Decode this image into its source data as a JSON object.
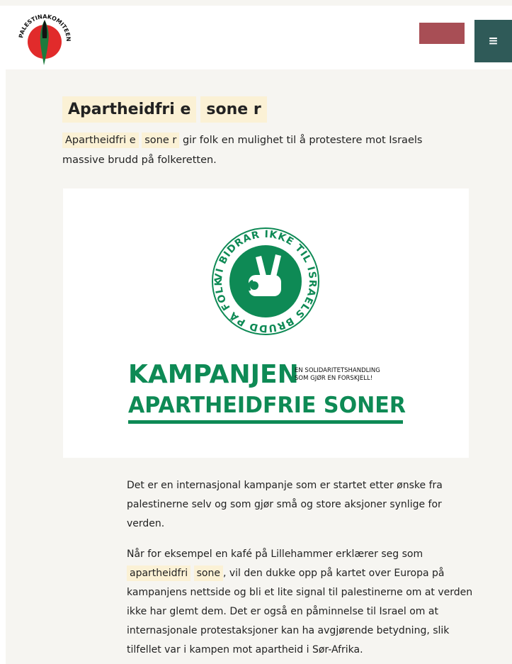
{
  "header": {
    "logo_text": "PALESTINAKOMITEEN I NORGE",
    "menu_icon": "hamburger-icon",
    "colors": {
      "menu_bg": "#2f5a58",
      "red_button": "#a84e55"
    }
  },
  "article": {
    "title_part1": "Apartheidfri e",
    "title_part2": "sone r",
    "lead_hl1": "Apartheidfri e",
    "lead_hl2": "sone r",
    "lead_rest": " gir folk en mulighet til å protestere mot Israels massive brudd på folkeretten.",
    "banner": {
      "badge_text": "VI BIDRAR IKKE TIL ISRAELS BRUDD PÅ FOLKERETTEN",
      "line1": "KAMPANJEN",
      "line2": "APARTHEIDFRIE SONER",
      "tagline1": "EN SOLIDARITETSHANDLING",
      "tagline2": "SOM GJØR EN FORSKJELL!",
      "color": "#0e8a55"
    },
    "para1": "Det er en internasjonal kampanje som er startet etter ønske fra palestinerne selv og som gjør små og store aksjoner synlige for verden.",
    "para2_start": "Når for eksempel en kafé på Lillehammer erklærer seg som ",
    "para2_hl1": "apartheidfri",
    "para2_hl2": "sone",
    "para2_rest": ", vil den dukke opp på kartet over Europa på kampanjens nettside og bli et lite signal til palestinerne om at verden ikke har glemt dem. Det er også en påminnelse til Israel om at internasjonale protestaksjoner kan ha avgjørende betydning, slik tilfellet var i kampen mot apartheid i Sør-Afrika."
  }
}
